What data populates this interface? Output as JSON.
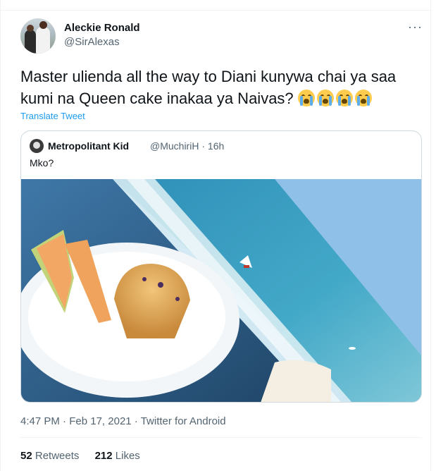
{
  "tweet": {
    "author_name": "Aleckie Ronald",
    "author_handle": "@SirAlexas",
    "more_icon": "···",
    "text": "Master ulienda all the way to Diani kunywa chai ya saa kumi na Queen cake inakaa ya Naivas?",
    "emoji_count": 4,
    "translate_label": "Translate Tweet",
    "time": "4:47 PM",
    "date": "Feb 17, 2021",
    "source": "Twitter for Android",
    "sep": "·",
    "retweets_count": "52",
    "retweets_label": "Retweets",
    "likes_count": "212",
    "likes_label": "Likes"
  },
  "quoted": {
    "author_name": "Metropolitant Kid",
    "author_handle": "@MuchiriH",
    "sep": "·",
    "age": "16h",
    "text": "Mko?"
  },
  "colors": {
    "link": "#1d9bf0",
    "secondary": "#536471",
    "border": "#cfd9de"
  }
}
